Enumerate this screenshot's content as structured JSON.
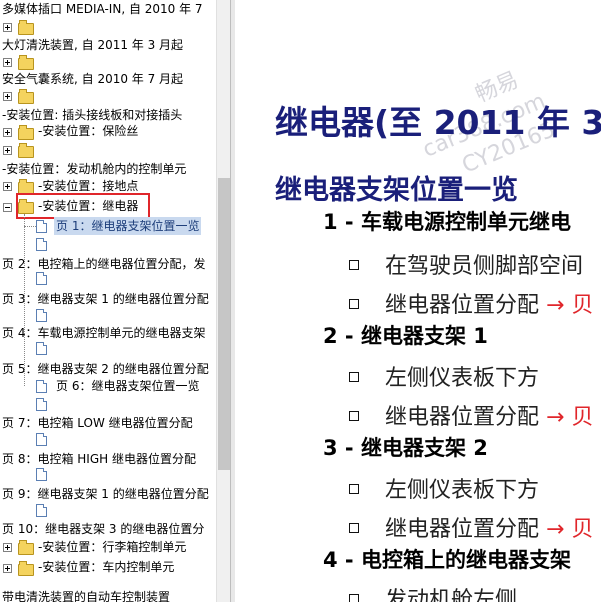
{
  "tree": {
    "items": [
      {
        "label": "多媒体插口 MEDIA-IN, 自 2010 年 7"
      },
      {
        "label": "大灯清洗装置, 自 2011 年 3 月起"
      },
      {
        "label": "安全气囊系统, 自 2010 年 7 月起"
      },
      {
        "label": "-安装位置: 插头接线板和对接插头"
      },
      {
        "label": "-安装位置：保险丝"
      },
      {
        "label": "-安装位置：发动机舱内的控制单元"
      },
      {
        "label": "-安装位置：接地点"
      },
      {
        "label": "-安装位置：继电器"
      },
      {
        "label": "页 1：继电器支架位置一览"
      },
      {
        "label": "页 2：电控箱上的继电器位置分配，发"
      },
      {
        "label": "页 3：继电器支架 1 的继电器位置分配"
      },
      {
        "label": "页 4：车载电源控制单元的继电器支架"
      },
      {
        "label": "页 5：继电器支架 2 的继电器位置分配"
      },
      {
        "label": "页 6：继电器支架位置一览"
      },
      {
        "label": "页 7：电控箱 LOW 继电器位置分配"
      },
      {
        "label": "页 8：电控箱 HIGH 继电器位置分配"
      },
      {
        "label": "页 9：继电器支架 1 的继电器位置分配"
      },
      {
        "label": "页 10：继电器支架 3 的继电器位置分"
      },
      {
        "label": "-安装位置：行李箱控制单元"
      },
      {
        "label": "-安装位置：车内控制单元"
      },
      {
        "label": "带电清洗装置的自动车控制装置"
      }
    ]
  },
  "content": {
    "title": "继电器(至 2011 年 3",
    "subtitle": "继电器支架位置一览",
    "sections": [
      {
        "num": "1 -",
        "label": "车载电源控制单元继电",
        "items": [
          "在驾驶员侧脚部空间",
          "继电器位置分配"
        ]
      },
      {
        "num": "2 -",
        "label": "继电器支架 1",
        "items": [
          "左侧仪表板下方",
          "继电器位置分配"
        ]
      },
      {
        "num": "3 -",
        "label": "继电器支架 2",
        "items": [
          "左侧仪表板下方",
          "继电器位置分配"
        ]
      },
      {
        "num": "4 -",
        "label": "电控箱上的继电器支架",
        "items": [
          "发动机舱左侧"
        ]
      }
    ],
    "arrow": "→ 贝",
    "watermark": [
      "畅易",
      "car388.com",
      "CY20165"
    ]
  },
  "colors": {
    "title": "#1a1f7a",
    "highlight_box": "#e0262b",
    "selected_bg": "#c9d9ef"
  }
}
